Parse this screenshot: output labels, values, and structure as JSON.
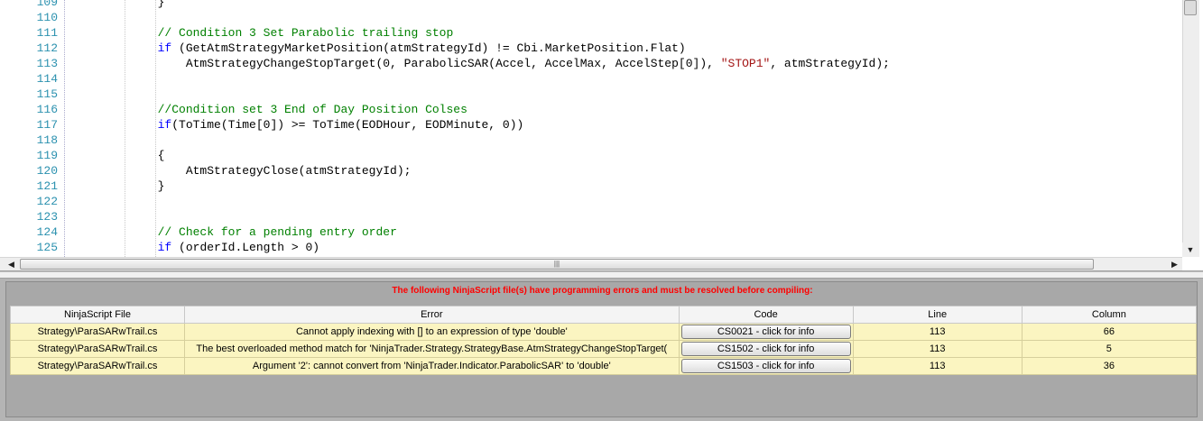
{
  "editor": {
    "lines": [
      {
        "n": "109",
        "segments": [
          {
            "t": "            }",
            "c": ""
          }
        ]
      },
      {
        "n": "110",
        "segments": []
      },
      {
        "n": "111",
        "segments": [
          {
            "t": "            ",
            "c": ""
          },
          {
            "t": "// Condition 3 Set Parabolic trailing stop",
            "c": "cm"
          }
        ]
      },
      {
        "n": "112",
        "segments": [
          {
            "t": "            ",
            "c": ""
          },
          {
            "t": "if",
            "c": "kw"
          },
          {
            "t": " (GetAtmStrategyMarketPosition(atmStrategyId) != Cbi.MarketPosition.Flat)",
            "c": ""
          }
        ]
      },
      {
        "n": "113",
        "segments": [
          {
            "t": "                AtmStrategyChangeStopTarget(0, ParabolicSAR(Accel, AccelMax, AccelStep[0]), ",
            "c": ""
          },
          {
            "t": "\"STOP1\"",
            "c": "str"
          },
          {
            "t": ", atmStrategyId);",
            "c": ""
          }
        ]
      },
      {
        "n": "114",
        "segments": []
      },
      {
        "n": "115",
        "segments": []
      },
      {
        "n": "116",
        "segments": [
          {
            "t": "            ",
            "c": ""
          },
          {
            "t": "//Condition set 3 End of Day Position Colses",
            "c": "cm"
          }
        ]
      },
      {
        "n": "117",
        "segments": [
          {
            "t": "            ",
            "c": ""
          },
          {
            "t": "if",
            "c": "kw"
          },
          {
            "t": "(ToTime(Time[0]) >= ToTime(EODHour, EODMinute, 0))",
            "c": ""
          }
        ]
      },
      {
        "n": "118",
        "segments": []
      },
      {
        "n": "119",
        "segments": [
          {
            "t": "            {",
            "c": ""
          }
        ]
      },
      {
        "n": "120",
        "segments": [
          {
            "t": "                AtmStrategyClose(atmStrategyId);",
            "c": ""
          }
        ]
      },
      {
        "n": "121",
        "segments": [
          {
            "t": "            }",
            "c": ""
          }
        ]
      },
      {
        "n": "122",
        "segments": []
      },
      {
        "n": "123",
        "segments": []
      },
      {
        "n": "124",
        "segments": [
          {
            "t": "            ",
            "c": ""
          },
          {
            "t": "// Check for a pending entry order",
            "c": "cm"
          }
        ]
      },
      {
        "n": "125",
        "segments": [
          {
            "t": "            ",
            "c": ""
          },
          {
            "t": "if",
            "c": "kw"
          },
          {
            "t": " (orderId.Length > 0)",
            "c": ""
          }
        ]
      }
    ],
    "hscroll_grip": "|||"
  },
  "errors": {
    "message": "The following NinjaScript file(s) have programming errors and must be resolved before compiling:",
    "columns": [
      "NinjaScript File",
      "Error",
      "Code",
      "Line",
      "Column"
    ],
    "rows": [
      {
        "file": "Strategy\\ParaSARwTrail.cs",
        "error": "Cannot apply indexing with [] to an expression of type 'double'",
        "code": "CS0021 - click for info",
        "line": "113",
        "column": "66"
      },
      {
        "file": "Strategy\\ParaSARwTrail.cs",
        "error": "The best overloaded method match for 'NinjaTrader.Strategy.StrategyBase.AtmStrategyChangeStopTarget(",
        "code": "CS1502 - click for info",
        "line": "113",
        "column": "5"
      },
      {
        "file": "Strategy\\ParaSARwTrail.cs",
        "error": "Argument '2': cannot convert from 'NinjaTrader.Indicator.ParabolicSAR' to 'double'",
        "code": "CS1503 - click for info",
        "line": "113",
        "column": "36"
      }
    ]
  }
}
